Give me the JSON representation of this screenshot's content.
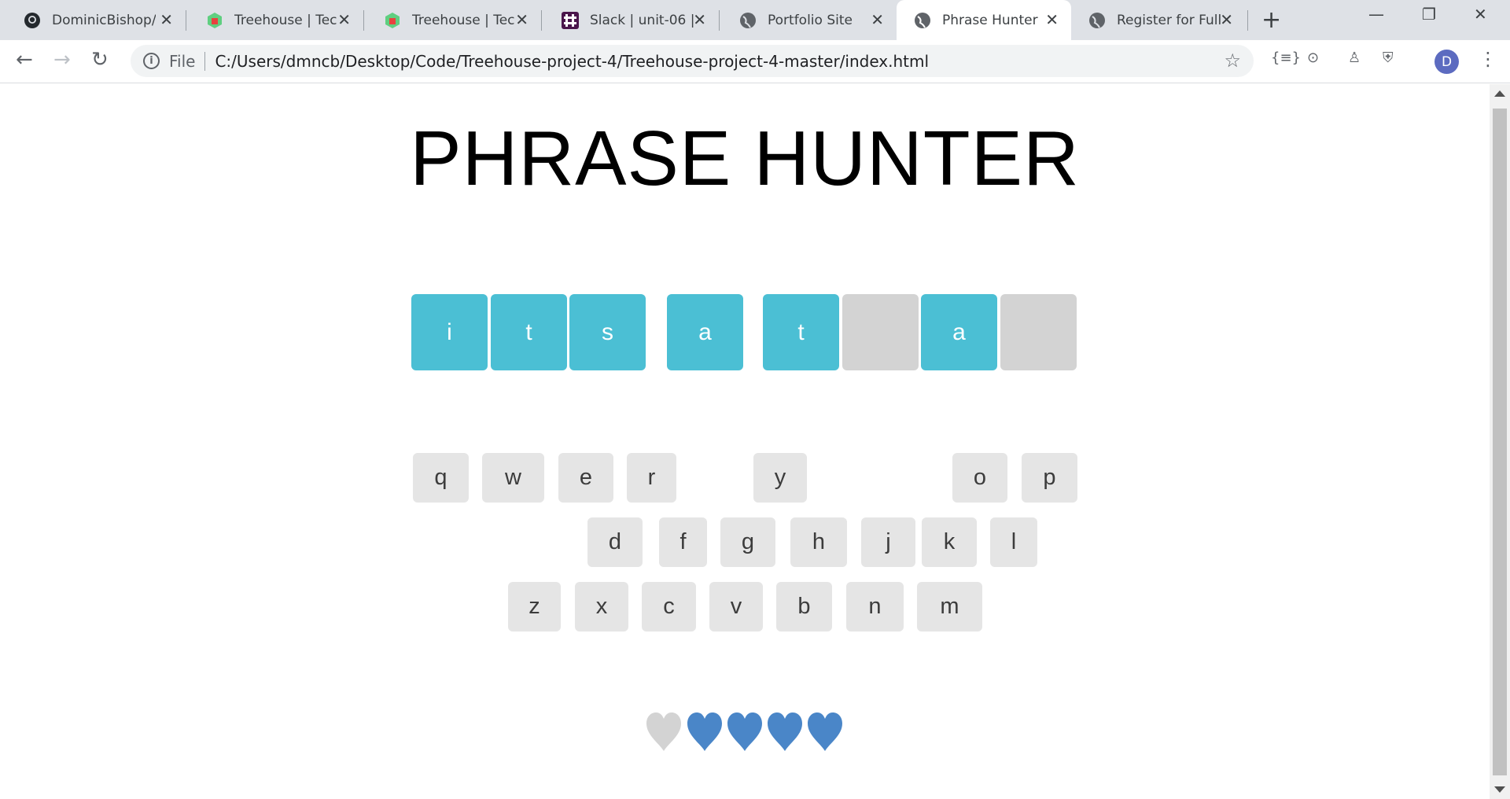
{
  "tabs": [
    {
      "title": "DominicBishop/",
      "icon": "github-icon"
    },
    {
      "title": "Treehouse | Tech",
      "icon": "treehouse-icon"
    },
    {
      "title": "Treehouse | Tech",
      "icon": "treehouse-icon"
    },
    {
      "title": "Slack | unit-06 |",
      "icon": "slack-icon"
    },
    {
      "title": "Portfolio Site",
      "icon": "globe-icon"
    },
    {
      "title": "Phrase Hunter",
      "icon": "globe-icon",
      "active": true
    },
    {
      "title": "Register for Full",
      "icon": "globe-icon"
    }
  ],
  "omnibox": {
    "scheme_label": "File",
    "url": "C:/Users/dmncb/Desktop/Code/Treehouse-project-4/Treehouse-project-4-master/index.html"
  },
  "profile_initial": "D",
  "game": {
    "title": "PHRASE HUNTER",
    "phrase": [
      {
        "letter": "i",
        "shown": true
      },
      {
        "letter": "t",
        "shown": true
      },
      {
        "letter": "s",
        "shown": true
      },
      {
        "letter": " ",
        "space": true
      },
      {
        "letter": "a",
        "shown": true
      },
      {
        "letter": " ",
        "space": true
      },
      {
        "letter": "t",
        "shown": true
      },
      {
        "letter": "",
        "shown": false
      },
      {
        "letter": "a",
        "shown": true
      },
      {
        "letter": "",
        "shown": false
      }
    ],
    "keyboard_rows": [
      [
        "q",
        "w",
        "e",
        "r",
        "y",
        "o",
        "p"
      ],
      [
        "d",
        "f",
        "g",
        "h",
        "j",
        "k",
        "l"
      ],
      [
        "z",
        "x",
        "c",
        "v",
        "b",
        "n",
        "m"
      ]
    ],
    "lives": {
      "total": 5,
      "lost": 1
    },
    "colors": {
      "shown": "#4bbfd4",
      "hidden": "#d3d3d3",
      "key": "#e5e5e5",
      "heart_live": "#4a86c8",
      "heart_lost": "#d3d3d3"
    }
  }
}
